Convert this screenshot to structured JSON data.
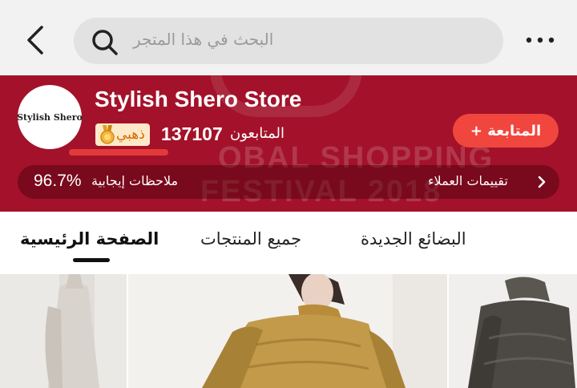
{
  "search": {
    "placeholder": "البحث في هذا المتجر"
  },
  "store": {
    "name": "Stylish Shero Store",
    "avatar_text": "Stylish Shero",
    "level_badge": "ذهبي",
    "followers_count": "137107",
    "followers_label": "المتابعون",
    "follow_label": "المتابعة +",
    "positive_feedback_value": "96.7%",
    "positive_feedback_label": "ملاحظات إيجابية",
    "reviews_label": "تقييمات العملاء",
    "banner_bg_text": [
      "OBAL SHOPPING",
      "FESTIVAL 2018"
    ]
  },
  "tabs": [
    {
      "label": "الصفحة الرئيسية",
      "active": true
    },
    {
      "label": "جميع المنتجات",
      "active": false
    },
    {
      "label": "البضائع الجديدة",
      "active": false
    }
  ],
  "colors": {
    "banner": "#a3122a",
    "follow_button": "#f1463e",
    "badge_bg": "#fde9c8",
    "badge_text": "#d36a00"
  },
  "icons": {
    "back": "chevron-left-icon",
    "search": "search-icon",
    "more": "more-dots-icon",
    "medal": "medal-icon",
    "reviews_arrow": "chevron-right-icon"
  }
}
